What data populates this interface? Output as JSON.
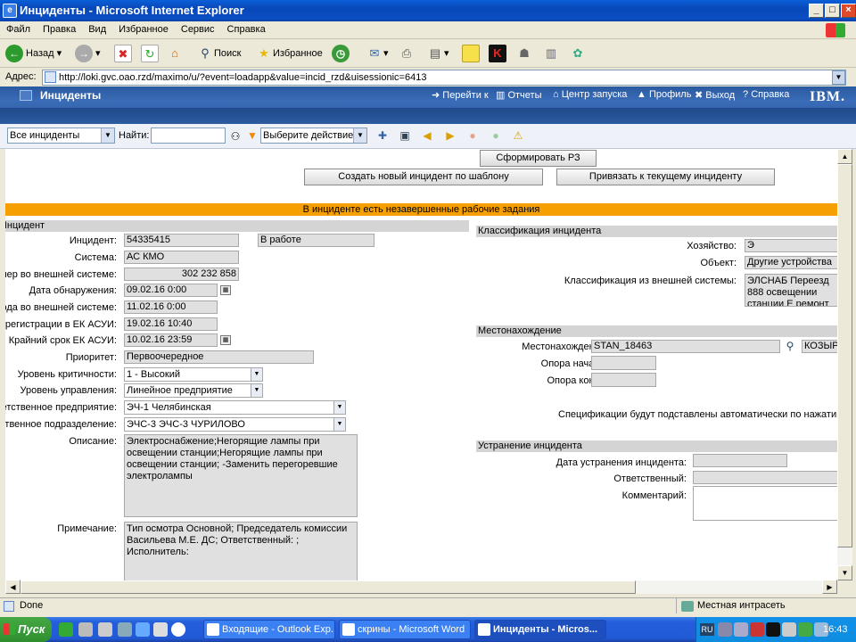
{
  "window": {
    "title": "Инциденты - Microsoft Internet Explorer",
    "min": "_",
    "max": "□",
    "close": "×"
  },
  "menu": [
    "Файл",
    "Правка",
    "Вид",
    "Избранное",
    "Сервис",
    "Справка"
  ],
  "toolbar": {
    "back": "Назад",
    "search": "Поиск",
    "favorites": "Избранное"
  },
  "address": {
    "label": "Адрес:",
    "url": "http://loki.gvc.oao.rzd/maximo/u/?event=loadapp&value=incid_rzd&uisessionic=6413"
  },
  "app": {
    "title": "Инциденты",
    "nav": [
      "Перейти к",
      "Отчеты",
      "Центр запуска",
      "Профиль",
      "Выход",
      "Справка"
    ],
    "brand": "IBM."
  },
  "actionbar": {
    "query": "Все инциденты",
    "find_label": "Найти:",
    "find_value": "",
    "action": "Выберите действие"
  },
  "buttons": {
    "form_rz": "Сформировать РЗ",
    "create_template": "Создать новый инцидент по шаблону",
    "link_current": "Привязать к текущему инциденту"
  },
  "warning": "В инциденте есть незавершенные рабочие задания",
  "incident": {
    "section": "Инцидент",
    "labels": {
      "id": "Инцидент:",
      "system": "Система:",
      "ext_num": "Номер во внешней системе:",
      "detected": "Дата обнаружения:",
      "ext_entered": "Дата ввода во внешней системе:",
      "registered": "Дата регистрации в ЕК АСУИ:",
      "deadline": "Крайний срок ЕК АСУИ:",
      "priority": "Приоритет:",
      "criticality": "Уровень критичности:",
      "mgmt_level": "Уровень управления:",
      "resp_org": "Ответственное предприятие:",
      "resp_dept": "Ответственное подразделение:",
      "description": "Описание:",
      "note": "Примечание:"
    },
    "values": {
      "id": "54335415",
      "status": "В работе",
      "system": "АС КМО",
      "ext_num": "302 232 858",
      "detected": "09.02.16 0:00",
      "ext_entered": "11.02.16 0:00",
      "registered": "19.02.16 10:40",
      "deadline": "10.02.16 23:59",
      "priority": "Первоочередное",
      "criticality": "1 - Высокий",
      "mgmt_level": "Линейное предприятие",
      "resp_org": "ЭЧ-1 Челябинская",
      "resp_dept": "ЭЧС-3 ЭЧС-3 ЧУРИЛОВО",
      "description": "Электроснабжение;Негорящие лампы при освещении станции;Негорящие лампы при освещении станции; -Заменить перегоревшие электролампы",
      "note": "Тип осмотра Основной; Председатель комиссии Васильева М.Е. ДС; Ответственный: ; Исполнитель:"
    }
  },
  "classification": {
    "section": "Классификация инцидента",
    "labels": {
      "economy": "Хозяйство:",
      "object": "Объект:",
      "ext_class": "Классификация из внешней системы:"
    },
    "values": {
      "economy": "Э",
      "object": "Другие устройства",
      "ext_class": "ЭЛСНАБ Переезд 888 освещении станции Е ремонт автомата нез"
    }
  },
  "location": {
    "section": "Местонахождение",
    "labels": {
      "location": "Местонахождение:",
      "start": "Опора начала:",
      "end": "Опора конца:"
    },
    "values": {
      "location": "STAN_18463",
      "location_name": "КОЗЫРЕ",
      "start": "",
      "end": ""
    },
    "spec_note": "Спецификации будут подставлены автоматически по нажатию к"
  },
  "resolution": {
    "section": "Устранение инцидента",
    "labels": {
      "date": "Дата устранения инцидента:",
      "responsible": "Ответственный:",
      "comment": "Комментарий:"
    },
    "values": {
      "date": "",
      "responsible": "",
      "comment": ""
    }
  },
  "status": {
    "left": "Done",
    "zone": "Местная интрасеть"
  },
  "taskbar": {
    "start": "Пуск",
    "tasks": [
      "Входящие - Outlook Exp...",
      "скрины - Microsoft Word",
      "Инциденты - Micros..."
    ],
    "clock": "16:43",
    "lang": "RU"
  }
}
